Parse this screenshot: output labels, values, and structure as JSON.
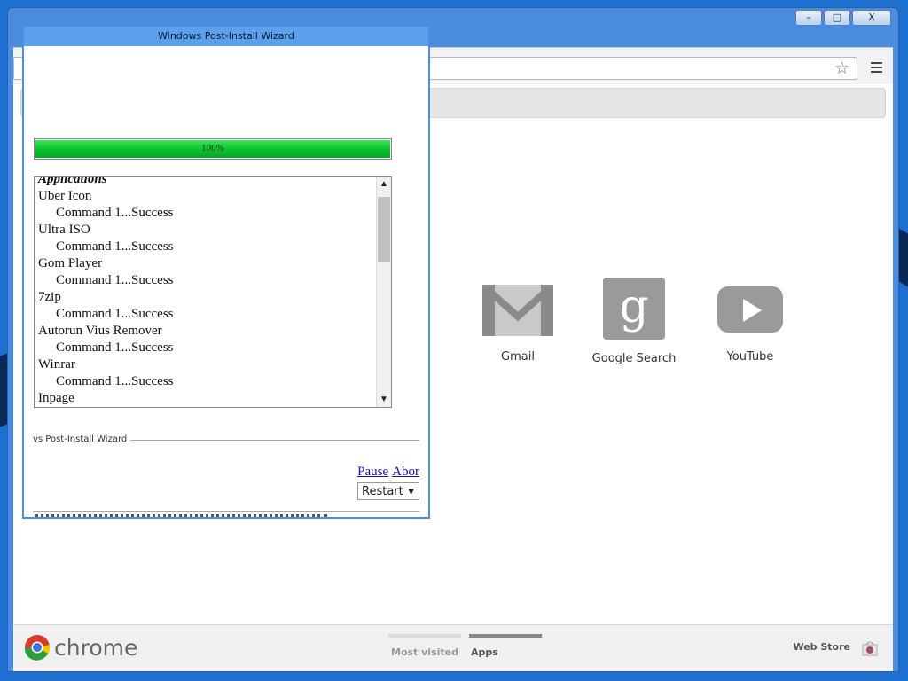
{
  "window": {
    "controls": {
      "minimize": "–",
      "maximize": "□",
      "close": "X"
    }
  },
  "wizard": {
    "title": "Windows Post-Install Wizard",
    "progress": {
      "percent": 100,
      "label": "100%"
    },
    "results": {
      "header": "Applications",
      "rows": [
        {
          "text": "Uber Icon",
          "indent": false
        },
        {
          "text": "Command 1...Success",
          "indent": true
        },
        {
          "text": "Ultra ISO",
          "indent": false
        },
        {
          "text": "Command 1...Success",
          "indent": true
        },
        {
          "text": "Gom Player",
          "indent": false
        },
        {
          "text": "Command 1...Success",
          "indent": true
        },
        {
          "text": "7zip",
          "indent": false
        },
        {
          "text": "Command 1...Success",
          "indent": true
        },
        {
          "text": "Autorun Vius Remover",
          "indent": false
        },
        {
          "text": "Command 1...Success",
          "indent": true
        },
        {
          "text": "Winrar",
          "indent": false
        },
        {
          "text": "Command 1...Success",
          "indent": true
        },
        {
          "text": "Inpage",
          "indent": false
        }
      ]
    },
    "section_label": "vs Post-Install Wizard",
    "links": {
      "pause": "Pause",
      "abort": "Abor"
    },
    "restart_option": "Restart"
  },
  "new_tab": {
    "apps": [
      {
        "label": "Gmail",
        "icon": "gmail-icon"
      },
      {
        "label": "Google Search",
        "icon": "google-search-icon"
      },
      {
        "label": "YouTube",
        "icon": "youtube-icon"
      }
    ],
    "brand": "chrome",
    "tabs": {
      "most_visited": "Most visited",
      "apps": "Apps"
    },
    "web_store": "Web Store"
  },
  "colors": {
    "desktop": "#1d6fd0",
    "progress_green": "#07c52c",
    "wizard_border": "#4a90e2"
  }
}
